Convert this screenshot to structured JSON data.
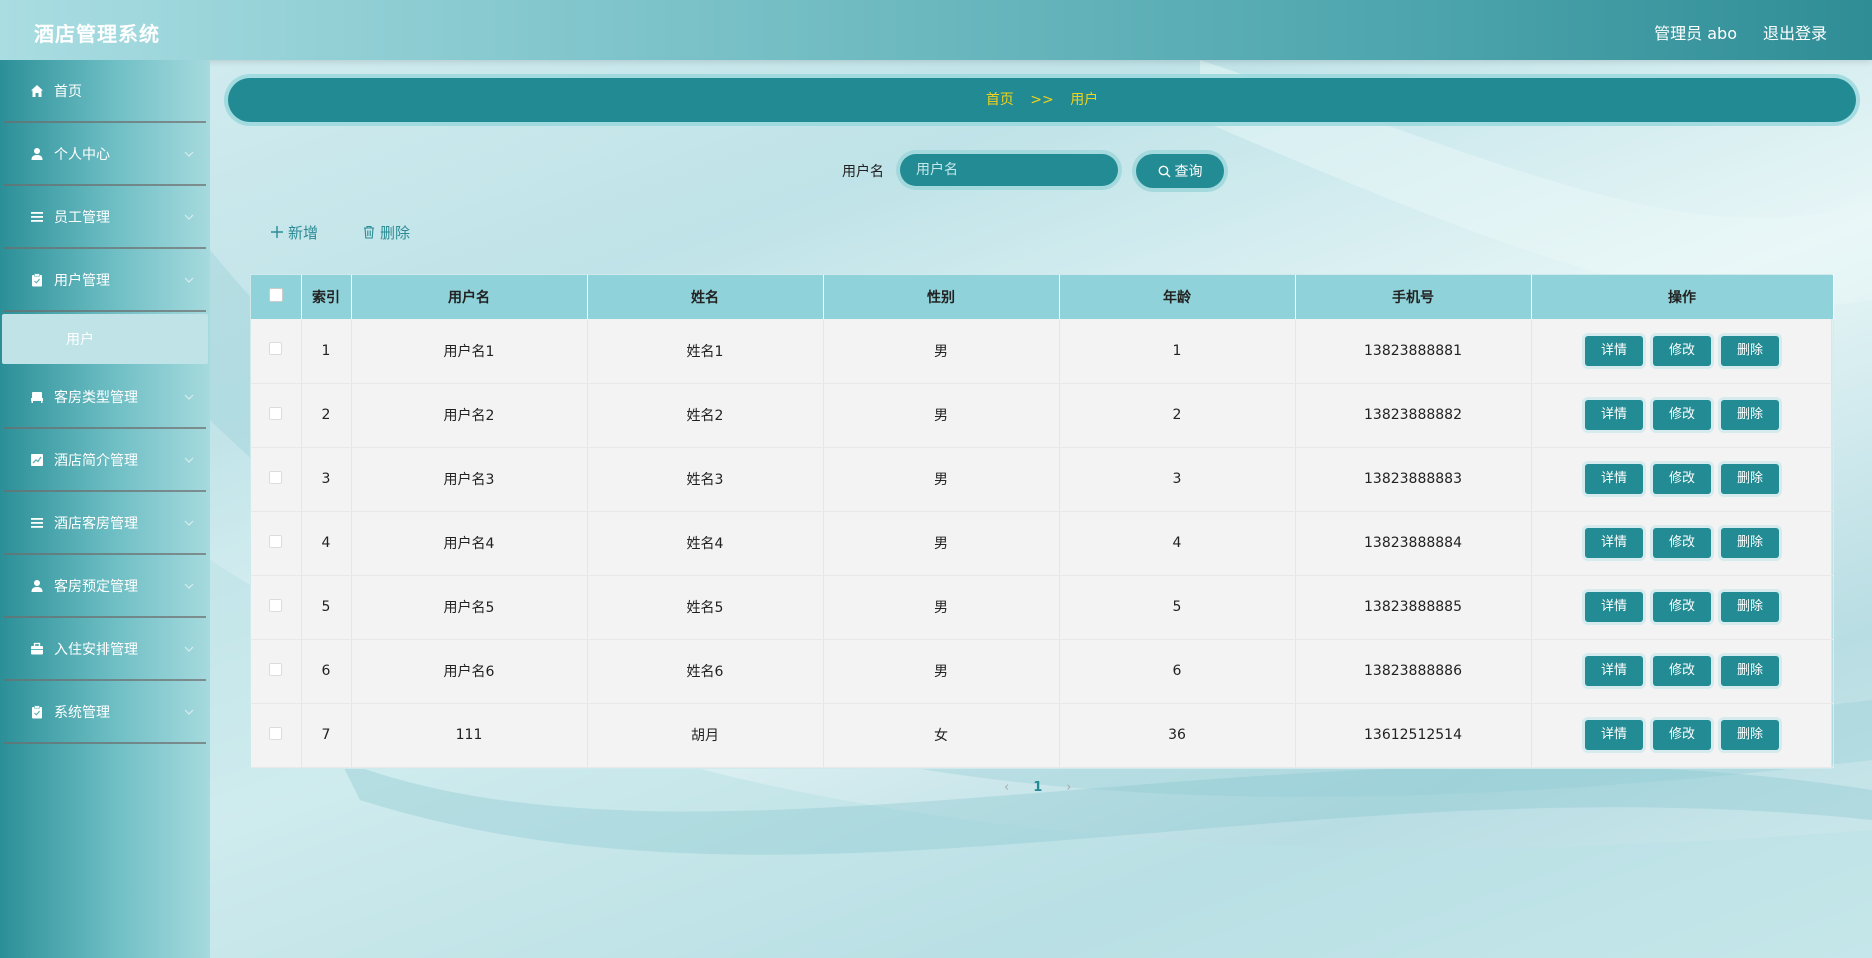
{
  "header": {
    "app_title": "酒店管理系统",
    "user_info": "管理员 abo",
    "logout": "退出登录"
  },
  "sidebar": {
    "items": [
      {
        "label": "首页",
        "icon": "home-icon"
      },
      {
        "label": "个人中心",
        "icon": "user-icon"
      },
      {
        "label": "员工管理",
        "icon": "list-icon"
      },
      {
        "label": "用户管理",
        "icon": "clipboard-icon",
        "expanded": true,
        "children": [
          {
            "label": "用户"
          }
        ]
      },
      {
        "label": "客房类型管理",
        "icon": "bed-icon"
      },
      {
        "label": "酒店简介管理",
        "icon": "chart-icon"
      },
      {
        "label": "酒店客房管理",
        "icon": "list-icon"
      },
      {
        "label": "客房预定管理",
        "icon": "user-icon"
      },
      {
        "label": "入住安排管理",
        "icon": "briefcase-icon"
      },
      {
        "label": "系统管理",
        "icon": "clipboard-icon"
      }
    ]
  },
  "breadcrumb": {
    "home": "首页",
    "separator": ">>",
    "current": "用户"
  },
  "search": {
    "label": "用户名",
    "placeholder": "用户名",
    "button": "查询"
  },
  "actions": {
    "add": "新增",
    "delete": "删除"
  },
  "table": {
    "headers": [
      "索引",
      "用户名",
      "姓名",
      "性别",
      "年龄",
      "手机号",
      "操作"
    ],
    "row_buttons": [
      "详情",
      "修改",
      "删除"
    ],
    "rows": [
      [
        "1",
        "用户名1",
        "姓名1",
        "男",
        "1",
        "13823888881"
      ],
      [
        "2",
        "用户名2",
        "姓名2",
        "男",
        "2",
        "13823888882"
      ],
      [
        "3",
        "用户名3",
        "姓名3",
        "男",
        "3",
        "13823888883"
      ],
      [
        "4",
        "用户名4",
        "姓名4",
        "男",
        "4",
        "13823888884"
      ],
      [
        "5",
        "用户名5",
        "姓名5",
        "男",
        "5",
        "13823888885"
      ],
      [
        "6",
        "用户名6",
        "姓名6",
        "男",
        "6",
        "13823888886"
      ],
      [
        "7",
        "111",
        "胡月",
        "女",
        "36",
        "13612512514"
      ]
    ]
  },
  "pagination": {
    "current_page": "1"
  },
  "colors": {
    "primary": "#238b93",
    "header_row": "#8fd2d9",
    "breadcrumb_text": "#f2d21b"
  }
}
